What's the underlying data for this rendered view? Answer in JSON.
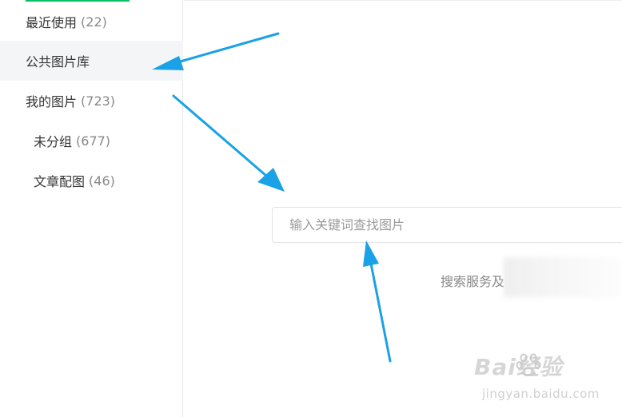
{
  "sidebar": {
    "items": [
      {
        "label": "最近使用",
        "count": "(22)",
        "active": false
      },
      {
        "label": "公共图片库",
        "count": "",
        "active": true
      },
      {
        "label": "我的图片",
        "count": "(723)",
        "active": false
      },
      {
        "label": "未分组",
        "count": "(677)",
        "active": false
      },
      {
        "label": "文章配图",
        "count": "(46)",
        "active": false
      }
    ]
  },
  "main": {
    "search": {
      "placeholder": "输入关键词查找图片",
      "value": ""
    },
    "service_note": "搜索服务及"
  },
  "watermark": {
    "brand": "Bai经验",
    "url": "jingyan.baidu.com"
  },
  "colors": {
    "accent": "#07c160",
    "annotation_arrow": "#1aa1e6",
    "active_bg": "#f4f5f7"
  }
}
